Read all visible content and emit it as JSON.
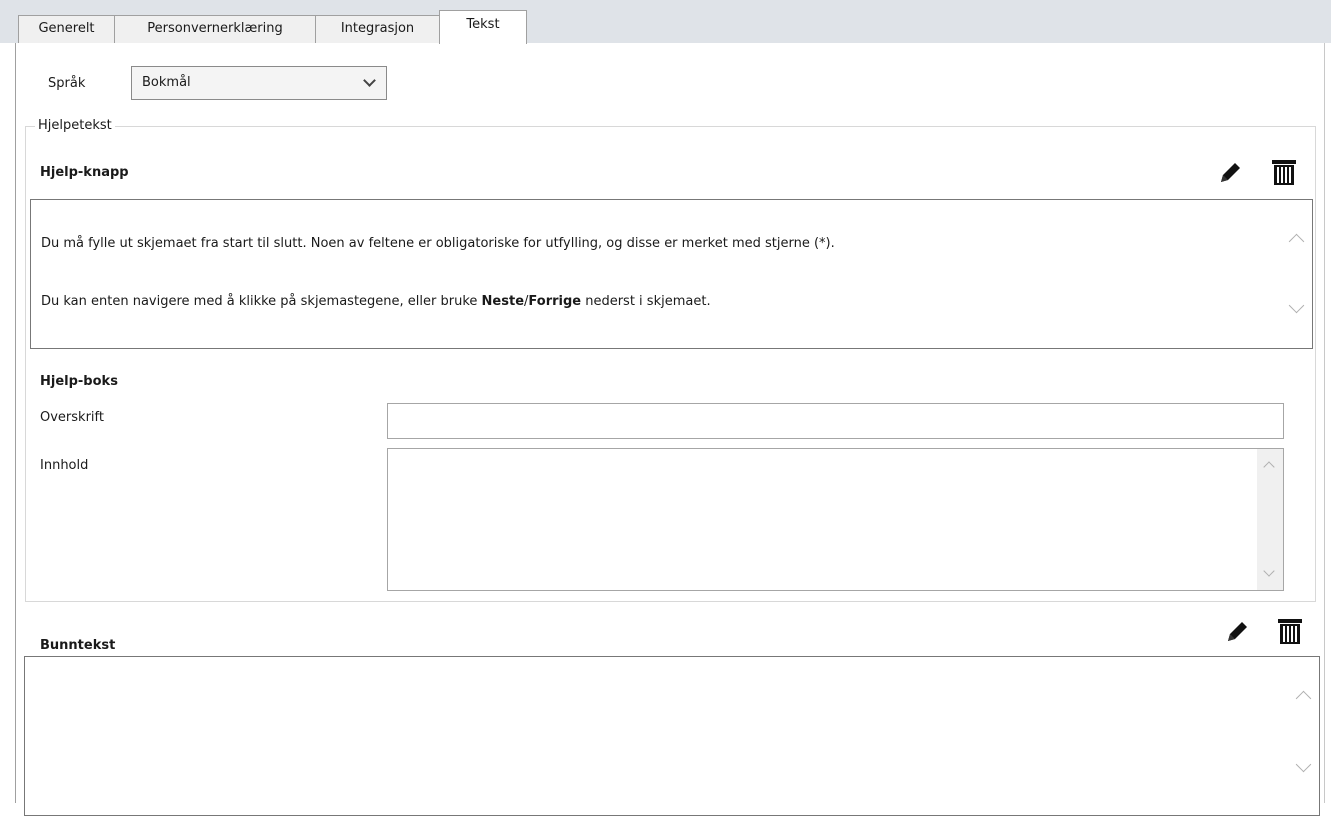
{
  "tabs": [
    {
      "label": "Generelt"
    },
    {
      "label": "Personvernerklæring"
    },
    {
      "label": "Integrasjon"
    },
    {
      "label": "Tekst"
    }
  ],
  "language": {
    "label": "Språk",
    "value": "Bokmål"
  },
  "help_text_group": {
    "legend": "Hjelpetekst",
    "help_button": {
      "title": "Hjelp-knapp",
      "line1": "Du må fylle ut skjemaet fra start til slutt. Noen av feltene er obligatoriske for utfylling, og disse er merket med stjerne (*).",
      "line2_pre": "Du kan enten navigere med å klikke på skjemastegene, eller bruke ",
      "line2_bold1": "Neste",
      "line2_sep": "/",
      "line2_bold2": "Forrige",
      "line2_post": " nederst i skjemaet."
    },
    "help_box": {
      "title": "Hjelp-boks",
      "heading_label": "Overskrift",
      "heading_value": "",
      "content_label": "Innhold",
      "content_value": ""
    }
  },
  "footer": {
    "title": "Bunntekst",
    "value": ""
  },
  "icons": {
    "edit": "pencil-icon",
    "delete": "trash-icon"
  }
}
